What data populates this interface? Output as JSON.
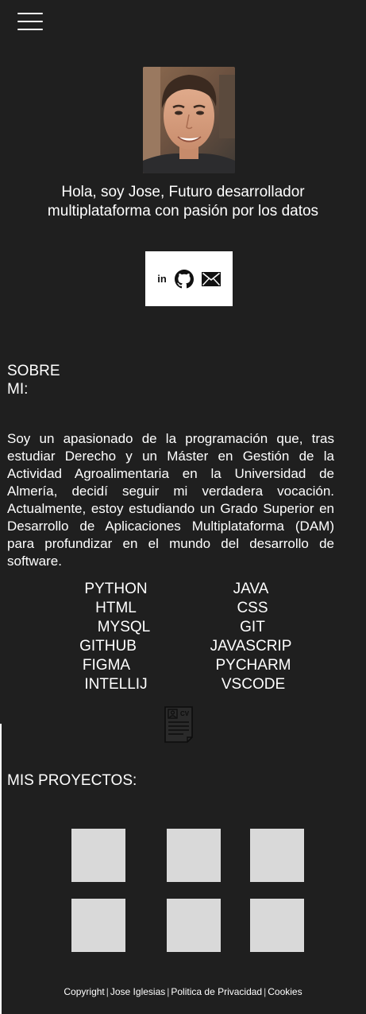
{
  "hero": {
    "intro": "Hola, soy Jose, Futuro desarrollador multiplataforma con pasión por los datos"
  },
  "social": {
    "linkedin_label": "in",
    "icons": [
      "linkedin-icon",
      "github-icon",
      "mail-icon"
    ]
  },
  "about": {
    "heading_line1": "SOBRE",
    "heading_line2": "MI:",
    "text": "Soy un apasionado de la programación que, tras estudiar Derecho y un Máster en Gestión de la Actividad Agroalimentaria en la Universidad de Almería, decidí seguir mi verdadera vocación. Actualmente, estoy estudiando un Grado Superior en Desarrollo de Aplicaciones Multiplataforma (DAM) para profundizar en el mundo del desarrollo de software."
  },
  "skills": {
    "left": [
      "PYTHON",
      "HTML",
      "MYSQL",
      "GITHUB",
      "FIGMA",
      "INTELLIJ"
    ],
    "right": [
      "JAVA",
      "CSS",
      "GIT",
      "JAVASCRIP",
      "PYCHARM",
      "VSCODE"
    ]
  },
  "projects": {
    "heading": "MIS PROYECTOS:"
  },
  "footer": {
    "copyright": "Copyright",
    "author": "Jose Iglesias",
    "privacy": "Politica de Privacidad",
    "cookies": "Cookies"
  },
  "colors": {
    "background": "#1f1f1f",
    "text": "#ffffff",
    "placeholder": "#d9d9d9"
  }
}
